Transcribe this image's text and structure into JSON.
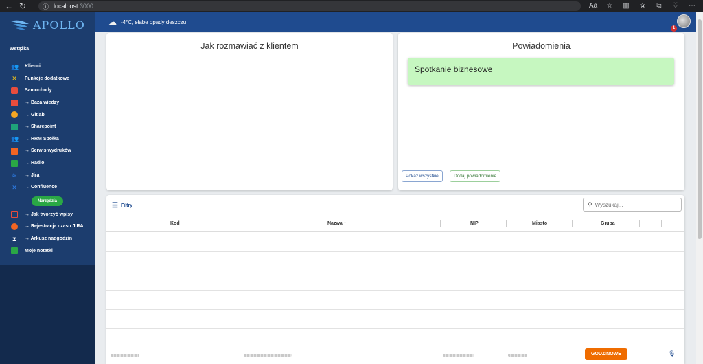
{
  "browser": {
    "url_host": "localhost",
    "url_port": ":3000"
  },
  "app": {
    "brand": "APOLLO",
    "weather": "-4°C, słabe opady deszczu",
    "notification_count": "1"
  },
  "sidebar": {
    "section_title": "Wstążka",
    "items": [
      {
        "label": "Klienci",
        "icon": "users-icon",
        "color": "#f5a623"
      },
      {
        "label": "Funkcje dodatkowe",
        "icon": "tools-icon",
        "color": "#f5c518"
      },
      {
        "label": "Samochody",
        "icon": "car-icon",
        "color": "#e84d3d"
      },
      {
        "label": "→ Baza wiedzy",
        "icon": "book-icon",
        "color": "#e84d3d"
      },
      {
        "label": "→ Gitlab",
        "icon": "github-icon",
        "color": "#f5a623"
      },
      {
        "label": "→ Sharepoint",
        "icon": "sharepoint-icon",
        "color": "#1fa37a"
      },
      {
        "label": "→ HRM Spółka",
        "icon": "team-icon",
        "color": "#2f80ed"
      },
      {
        "label": "→ Serwis wydruków",
        "icon": "printer-icon",
        "color": "#f26522"
      },
      {
        "label": "→ Radio",
        "icon": "radio-icon",
        "color": "#2aa845"
      },
      {
        "label": "→ Jira",
        "icon": "jira-icon",
        "color": "#2f80ed"
      },
      {
        "label": "→ Confluence",
        "icon": "confluence-icon",
        "color": "#2f80ed"
      }
    ],
    "badge": "Narzędzia",
    "tools": [
      {
        "label": "→ Jak tworzyć wpisy",
        "icon": "calendar-icon",
        "color": "#e84d3d"
      },
      {
        "label": "→ Rejestracja czasu JIRA",
        "icon": "clock-icon",
        "color": "#f26522"
      },
      {
        "label": "→ Arkusz nadgodzin",
        "icon": "hourglass-icon",
        "color": "#ffffff"
      },
      {
        "label": "Moje notatki",
        "icon": "notes-icon",
        "color": "#2aa845"
      }
    ]
  },
  "cards": {
    "left_title": "Jak rozmawiać z klientem",
    "right_title": "Powiadomienia",
    "notification": "Spotkanie biznesowe",
    "show_all": "Pokaż wszystkie",
    "add_notification": "Dodaj powiadomienie"
  },
  "table": {
    "filter_label": "Filtry",
    "search_placeholder": "Wyszukaj...",
    "columns": [
      "Kod",
      "Nazwa",
      "NIP",
      "Miasto",
      "Grupa"
    ],
    "sort_indicator": "↑",
    "group_button": "GODZINOWE"
  }
}
